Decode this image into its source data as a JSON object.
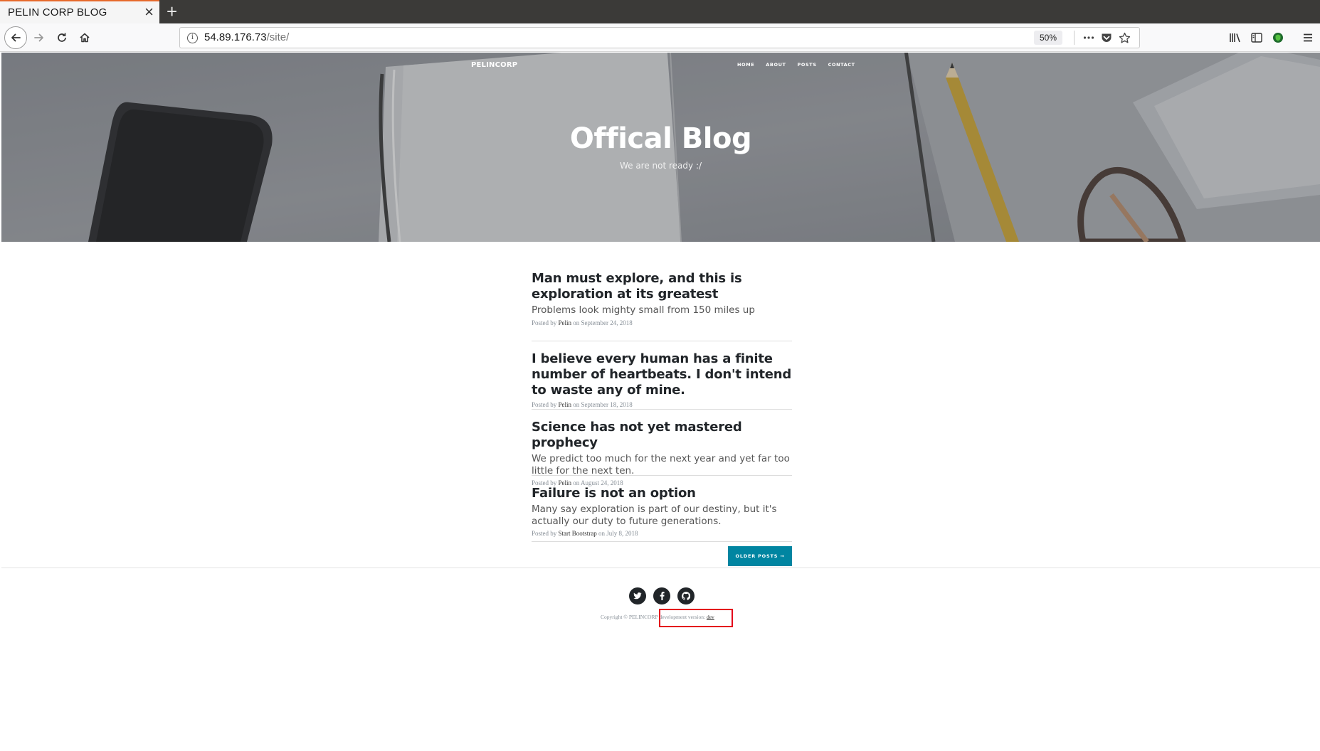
{
  "browser": {
    "tab_title": "PELIN CORP BLOG",
    "url_host": "54.89.176.73",
    "url_path": "/site/",
    "zoom": "50%"
  },
  "site": {
    "brand": "PELINCORP",
    "nav": [
      "HOME",
      "ABOUT",
      "POSTS",
      "CONTACT"
    ],
    "hero_title": "Offical Blog",
    "hero_subtitle": "We are not ready :/"
  },
  "posts": [
    {
      "title": "Man must explore, and this is exploration at its greatest",
      "subtitle": "Problems look mighty small from 150 miles up",
      "meta_prefix": "Posted by",
      "author": "Pelin",
      "meta_suffix": "on September 24, 2018"
    },
    {
      "title": "I believe every human has a finite number of heartbeats. I don't intend to waste any of mine.",
      "subtitle": "",
      "meta_prefix": "Posted by",
      "author": "Pelin",
      "meta_suffix": "on September 18, 2018"
    },
    {
      "title": "Science has not yet mastered prophecy",
      "subtitle": "We predict too much for the next year and yet far too little for the next ten.",
      "meta_prefix": "Posted by",
      "author": "Pelin",
      "meta_suffix": "on August 24, 2018"
    },
    {
      "title": "Failure is not an option",
      "subtitle": "Many say exploration is part of our destiny, but it's actually our duty to future generations.",
      "meta_prefix": "Posted by",
      "author": "Start Bootstrap",
      "meta_suffix": "on July 8, 2018"
    }
  ],
  "pager": {
    "older_label": "OLDER POSTS →"
  },
  "footer": {
    "copyright": "Copyright © PELINCORP",
    "dev_text": " development version: ",
    "dev_link": "dev"
  },
  "icons": {
    "twitter": "twitter-icon",
    "facebook": "facebook-icon",
    "github": "github-icon"
  },
  "colors": {
    "accent_button": "#0085a1",
    "tab_accent": "#e66a2c",
    "highlight_box": "#e3001b"
  }
}
